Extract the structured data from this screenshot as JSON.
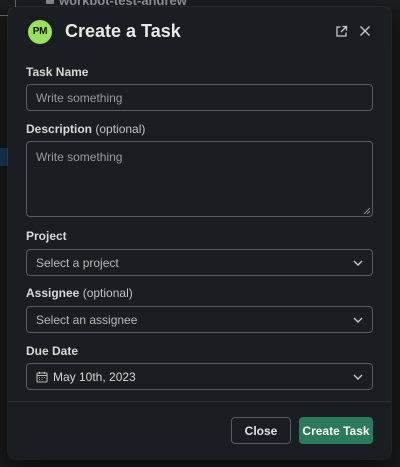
{
  "background": {
    "workspace_name": "workbot-test-andrew"
  },
  "modal": {
    "app_badge": "PM",
    "title": "Create a Task",
    "fields": {
      "task_name": {
        "label": "Task Name",
        "placeholder": "Write something",
        "value": ""
      },
      "description": {
        "label": "Description",
        "optional_label": "(optional)",
        "placeholder": "Write something",
        "value": ""
      },
      "project": {
        "label": "Project",
        "placeholder": "Select a project"
      },
      "assignee": {
        "label": "Assignee",
        "optional_label": "(optional)",
        "placeholder": "Select an assignee"
      },
      "due_date": {
        "label": "Due Date",
        "value": "May 10th, 2023"
      }
    },
    "buttons": {
      "close_label": "Close",
      "create_label": "Create Task"
    }
  },
  "colors": {
    "modal_bg": "#1a1d21",
    "logo_bg": "#9be15d",
    "primary_button": "#2b7a5d",
    "border": "#5a5c5f"
  },
  "icons": {
    "header_open": "external-link-icon",
    "header_close": "close-icon",
    "select_arrow": "chevron-down-icon",
    "date_picker": "calendar-icon"
  }
}
